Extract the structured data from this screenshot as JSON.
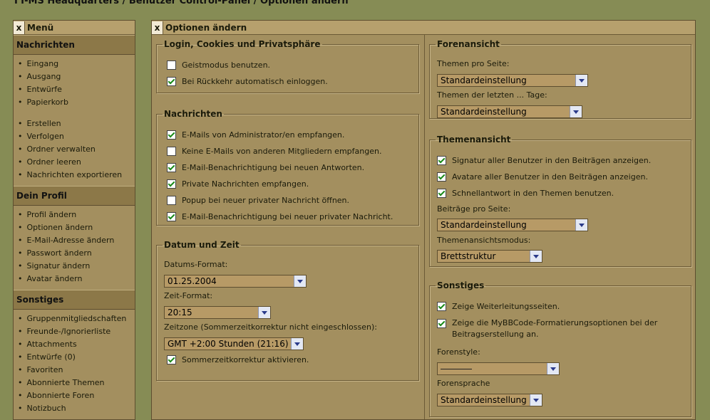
{
  "breadcrumb": "TT-MS Headquarters / Benutzer Control-Panel / Optionen ändern",
  "menu": {
    "close": "x",
    "title": "Menü",
    "sections": [
      {
        "heading": "Nachrichten",
        "items": [
          "Eingang",
          "Ausgang",
          "Entwürfe",
          "Papierkorb"
        ],
        "items2": [
          "Erstellen",
          "Verfolgen",
          "Ordner verwalten",
          "Ordner leeren",
          "Nachrichten exportieren"
        ]
      },
      {
        "heading": "Dein Profil",
        "items": [
          "Profil ändern",
          "Optionen ändern",
          "E-Mail-Adresse ändern",
          "Passwort ändern",
          "Signatur ändern",
          "Avatar ändern"
        ]
      },
      {
        "heading": "Sonstiges",
        "items": [
          "Gruppenmitgliedschaften",
          "Freunde-/Ignorierliste",
          "Attachments",
          "Entwürfe (0)",
          "Favoriten",
          "Abonnierte Themen",
          "Abonnierte Foren",
          "Notizbuch"
        ]
      }
    ]
  },
  "main": {
    "close": "x",
    "title": "Optionen ändern",
    "login": {
      "legend": "Login, Cookies und Privatsphäre",
      "options": [
        {
          "label": "Geistmodus benutzen.",
          "checked": false
        },
        {
          "label": "Bei Rückkehr automatisch einloggen.",
          "checked": true
        }
      ]
    },
    "messages": {
      "legend": "Nachrichten",
      "options": [
        {
          "label": "E-Mails von Administrator/en empfangen.",
          "checked": true
        },
        {
          "label": "Keine E-Mails von anderen Mitgliedern empfangen.",
          "checked": false
        },
        {
          "label": "E-Mail-Benachrichtigung bei neuen Antworten.",
          "checked": true
        },
        {
          "label": "Private Nachrichten empfangen.",
          "checked": true
        },
        {
          "label": "Popup bei neuer privater Nachricht öffnen.",
          "checked": false
        },
        {
          "label": "E-Mail-Benachrichtigung bei neuer privater Nachricht.",
          "checked": true
        }
      ]
    },
    "datetime": {
      "legend": "Datum und Zeit",
      "date_label": "Datums-Format:",
      "date_value": "01.25.2004",
      "time_label": "Zeit-Format:",
      "time_value": "20:15",
      "tz_label": "Zeitzone (Sommerzeitkorrektur nicht eingeschlossen):",
      "tz_value": "GMT +2:00 Stunden (21:16)",
      "dst_label": "Sommerzeitkorrektur aktivieren.",
      "dst_checked": true
    },
    "forum": {
      "legend": "Forenansicht",
      "topics_label": "Themen pro Seite:",
      "topics_value": "Standardeinstellung",
      "days_label": "Themen der letzten ... Tage:",
      "days_value": "Standardeinstellung"
    },
    "thread": {
      "legend": "Themenansicht",
      "options": [
        {
          "label": "Signatur aller Benutzer in den Beiträgen anzeigen.",
          "checked": true
        },
        {
          "label": "Avatare aller Benutzer in den Beiträgen anzeigen.",
          "checked": true
        },
        {
          "label": "Schnellantwort in den Themen benutzen.",
          "checked": true
        }
      ],
      "posts_label": "Beiträge pro Seite:",
      "posts_value": "Standardeinstellung",
      "mode_label": "Themenansichtsmodus:",
      "mode_value": "Brettstruktur"
    },
    "misc": {
      "legend": "Sonstiges",
      "options": [
        {
          "label": "Zeige Weiterleitungsseiten.",
          "checked": true
        },
        {
          "label": "Zeige die MyBBCode-Formatierungsoptionen bei der Beitragserstellung an.",
          "checked": true
        }
      ],
      "style_label": "Forenstyle:",
      "lang_label": "Forensprache",
      "lang_value": "Standardeinstellung"
    }
  }
}
